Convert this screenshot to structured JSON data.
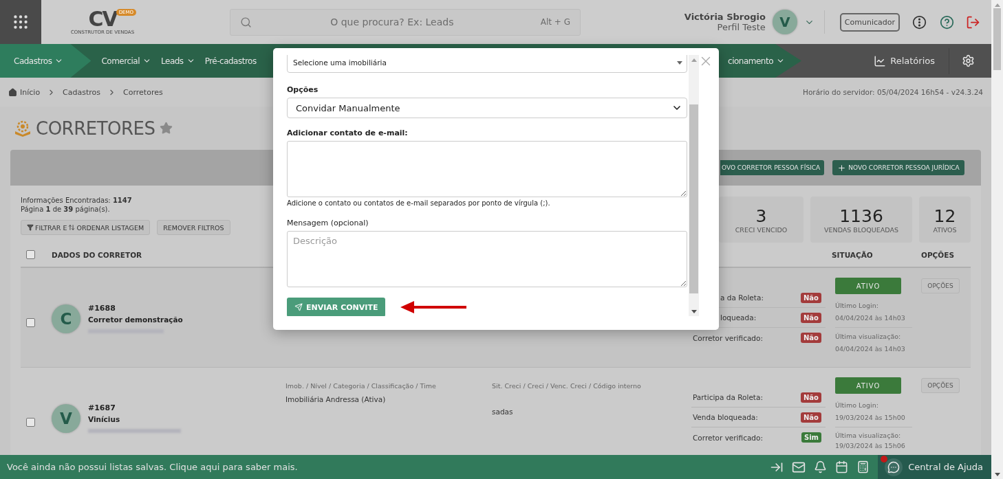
{
  "header": {
    "logo": {
      "mark": "CV",
      "badge": "DEMO",
      "tagline": "CONSTRUTOR DE VENDAS"
    },
    "search": {
      "placeholder": "O que procura? Ex: Leads",
      "shortcut": "Alt + G"
    },
    "user": {
      "name": "Victória Sbrogio",
      "profile": "Perfil Teste",
      "initial": "V"
    },
    "communicator": "Comunicador"
  },
  "nav": {
    "items": [
      {
        "label": "Cadastros",
        "selected": true
      },
      {
        "label": "Comercial",
        "selected": false
      },
      {
        "label": "Leads",
        "selected": false
      },
      {
        "label": "Pré-cadastros",
        "selected": false
      }
    ],
    "partial_item": "cionamento",
    "reports": "Relatórios"
  },
  "breadcrumb": [
    "Início",
    "Cadastros",
    "Corretores"
  ],
  "server_time": "Horário do servidor: 05/04/2024 16h54 - v24.3.24",
  "page": {
    "title": "CORRETORES",
    "favorite": false
  },
  "actions": [
    {
      "label": "OVO CORRETOR PESSOA FÍSICA",
      "kind": "cut"
    },
    {
      "label": "NOVO CORRETOR PESSOA JURÍDICA",
      "kind": "full"
    }
  ],
  "summary": {
    "found": "Informações Encontradas: **1147**",
    "pages": "Página **1** de **39** página(s)."
  },
  "filter_button": {
    "part_1": "FILTRAR E",
    "part_2": "ORDENAR LISTAGEM"
  },
  "remove_filters": "REMOVER FILTROS",
  "stats": [
    {
      "value": "3",
      "label": "CRECI VENCIDO"
    },
    {
      "value": "1136",
      "label": "VENDAS BLOQUEADAS"
    },
    {
      "value": "12",
      "label": "ATIVOS"
    }
  ],
  "table": {
    "select_all_checked": false,
    "columns": [
      "DADOS DO CORRETOR",
      "SITUAÇÃO",
      "OPÇÕES"
    ],
    "rows": [
      {
        "checked": false,
        "initial": "C",
        "code": "#1688",
        "name": "Corretor demonstração",
        "flags": [
          {
            "label": "a da Roleta:",
            "value": "Não",
            "on": false,
            "kind": "cut"
          },
          {
            "label": "loqueada:",
            "value": "Não",
            "on": false,
            "kind": "cut"
          },
          {
            "label": "Corretor verificado:",
            "value": "Não",
            "on": false,
            "kind": "full"
          }
        ],
        "status": "ATIVO",
        "last_login_label": "Último Login:",
        "last_login": "04/04/2024 às 14h03",
        "last_view_label": "Última visualização:",
        "last_view": "04/04/2024 às 14h03",
        "options": "OPÇÕES"
      },
      {
        "checked": false,
        "initial": "V",
        "code": "#1687",
        "name": "Vinícius",
        "imob_header": "Imob. / Nível / Categoria / Classificação / Time",
        "imob": "Imobiliária Andressa (Ativa)",
        "creci_header": "Sit. Creci / Creci / Venc. Creci / Código interno",
        "creci": "sadas",
        "flags": [
          {
            "label": "Participa da Roleta:",
            "value": "Não",
            "on": false,
            "kind": "full"
          },
          {
            "label": "Venda bloqueada:",
            "value": "Não",
            "on": false,
            "kind": "full"
          },
          {
            "label": "Corretor verificado:",
            "value": "Sim",
            "on": true,
            "kind": "full"
          }
        ],
        "status": "ATIVO",
        "last_login_label": "Último Login:",
        "last_login": "19/03/2024 às 15h00",
        "last_view_label": "Última visualização:",
        "last_view": "19/03/2024 às 15h06",
        "options": "OPÇÕES"
      }
    ]
  },
  "modal": {
    "agency_select": "Selecione uma imobiliária",
    "options_label": "Opções",
    "options_value": "Convidar Manualmente",
    "email_label": "Adicionar contato de e-mail:",
    "email_help": "Adicione o contato ou contatos de e-mail separados por ponto de vírgula (;).",
    "message_label": "Mensagem (opcional)",
    "message_placeholder": "Descrição",
    "submit": "ENVIAR CONVITE"
  },
  "footer": {
    "message": "Você ainda não possui listas salvas. Clique aqui para saber mais.",
    "help": "Central de Ajuda",
    "help_notification": true
  }
}
